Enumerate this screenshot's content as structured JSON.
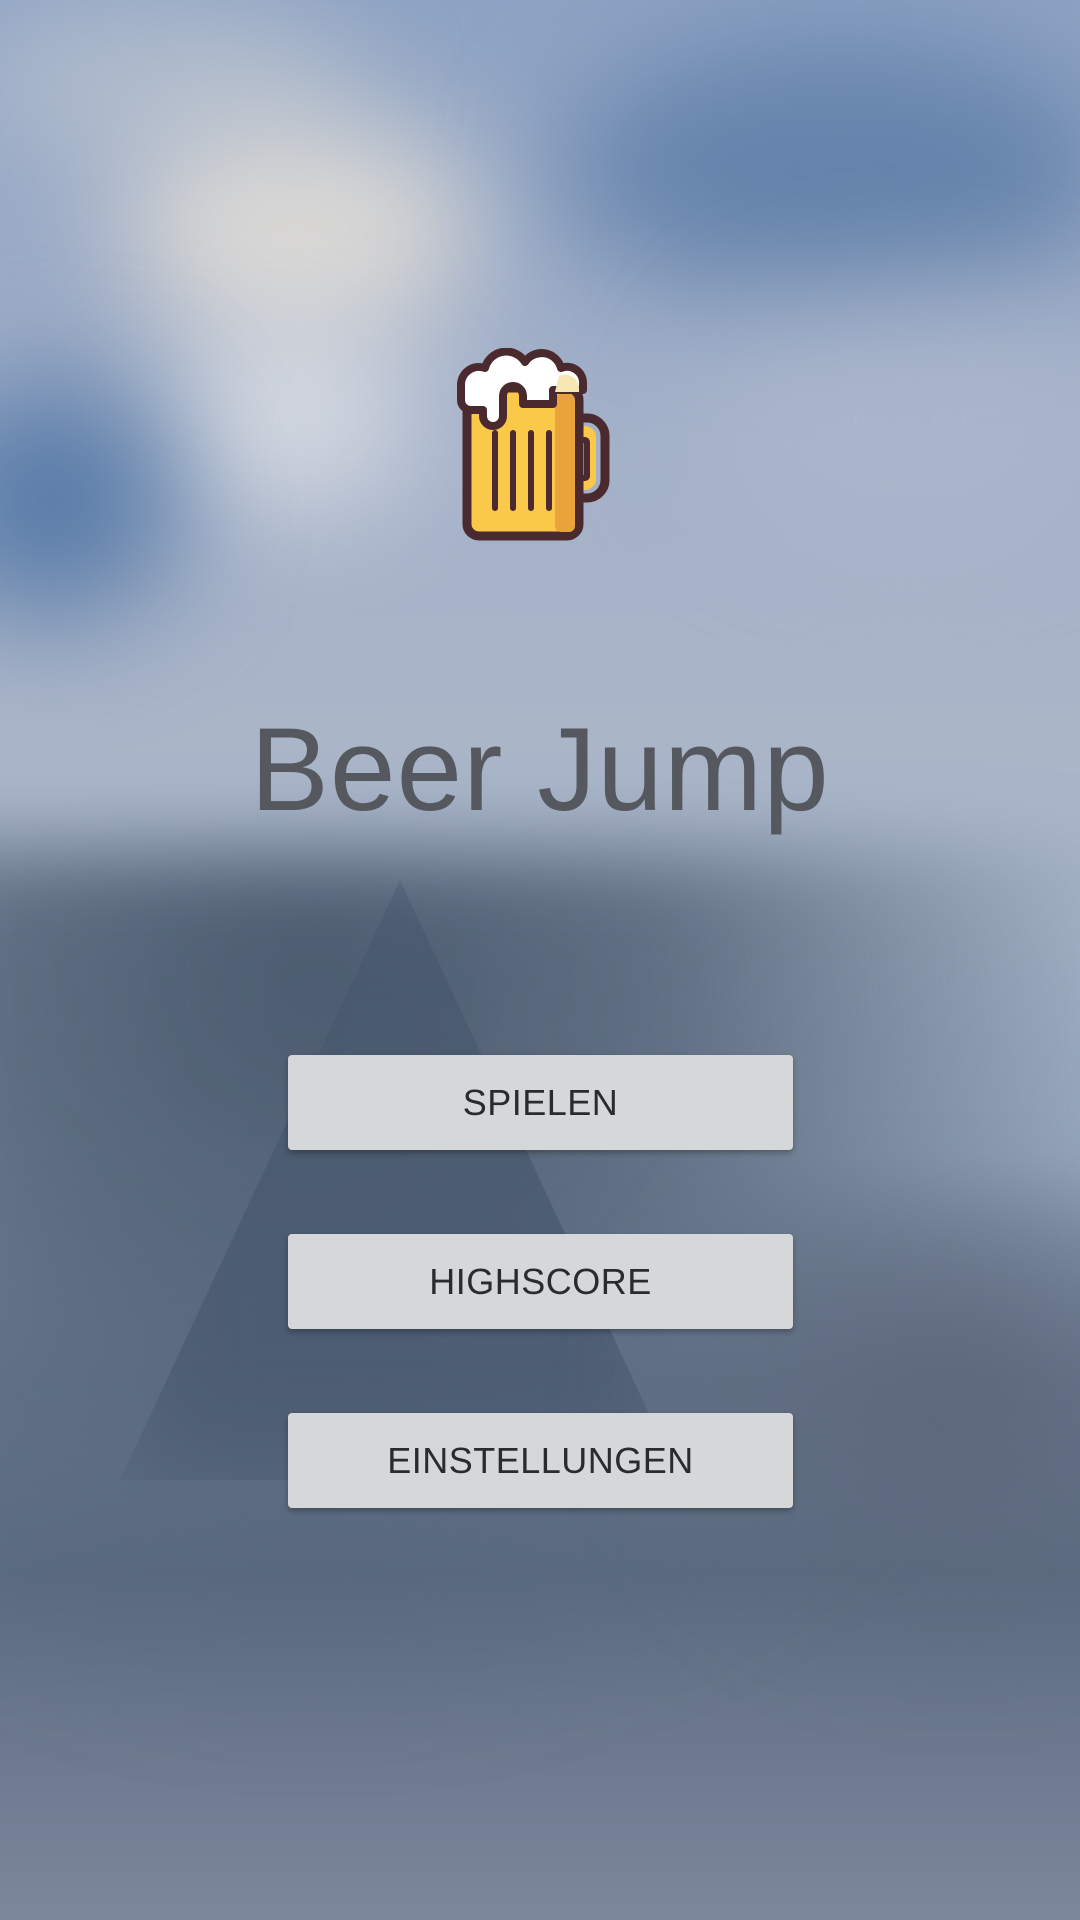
{
  "app": {
    "title": "Beer Jump",
    "logo_icon": "beer-mug-icon"
  },
  "menu": {
    "play_label": "SPIELEN",
    "highscore_label": "HIGHSCORE",
    "settings_label": "EINSTELLUNGEN"
  },
  "colors": {
    "title_text": "#55585e",
    "button_bg": "#d6d7d8",
    "button_text": "#2a2b2d",
    "beer": "#fbc94a",
    "beer_shade": "#e8a33a",
    "outline": "#4a2a2e",
    "foam": "#ffffff",
    "foam_shade": "#f6e7b5"
  }
}
